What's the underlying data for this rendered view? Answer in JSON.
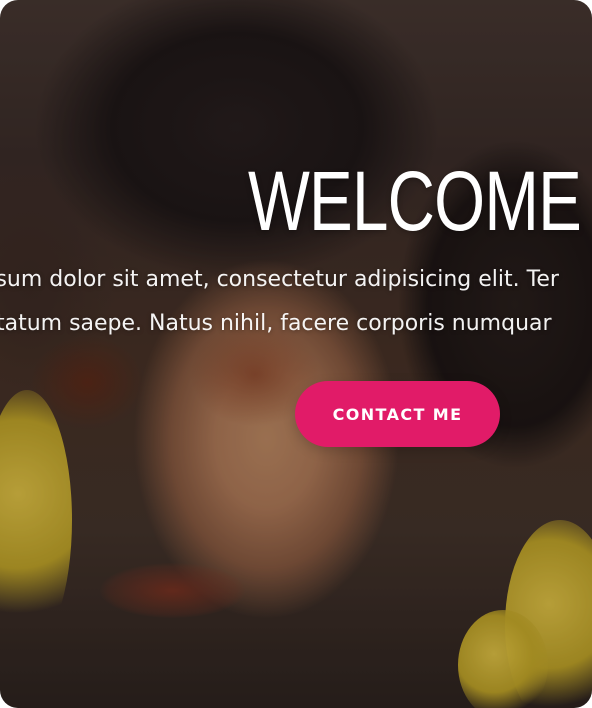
{
  "hero": {
    "title": "WELCOME",
    "lines": [
      "osum dolor sit amet, consectetur adipisicing elit. Ter",
      "ptatum saepe. Natus nihil, facere corporis numquar"
    ],
    "cta_label": "CONTACT ME",
    "colors": {
      "accent": "#e11b68",
      "text": "#ffffff"
    }
  }
}
